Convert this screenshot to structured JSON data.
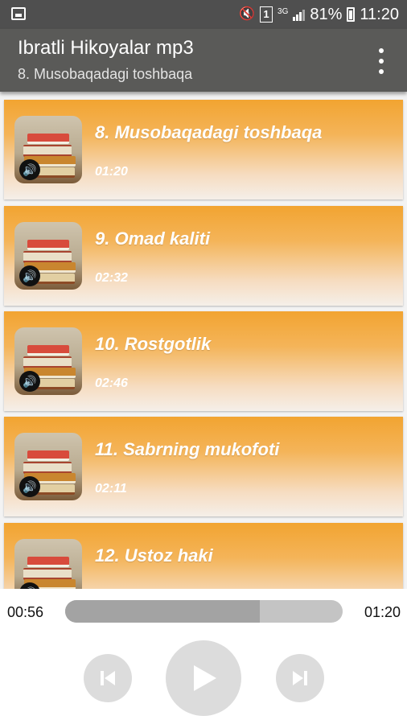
{
  "status_bar": {
    "battery_percent": "81%",
    "time": "11:20",
    "network": "3G",
    "sim_slot": "1",
    "icons": [
      "image-icon",
      "mute-icon",
      "sim-icon",
      "signal-icon",
      "battery-charging-icon"
    ]
  },
  "app_bar": {
    "title": "Ibratli Hikoyalar mp3",
    "subtitle": "8. Musobaqadagi toshbaqa",
    "menu_icon": "overflow-menu-icon"
  },
  "tracks": [
    {
      "title": "8. Musobaqadagi toshbaqa",
      "duration": "01:20"
    },
    {
      "title": "9. Omad kaliti",
      "duration": "02:32"
    },
    {
      "title": "10. Rostgotlik",
      "duration": "02:46"
    },
    {
      "title": "11. Sabrning mukofoti",
      "duration": "02:11"
    },
    {
      "title": "12. Ustoz haki",
      "duration": ""
    }
  ],
  "player": {
    "current_time": "00:56",
    "total_time": "01:20",
    "progress_fraction": 0.7,
    "buttons": [
      "previous-icon",
      "play-icon",
      "next-icon"
    ]
  },
  "colors": {
    "card_top": "#f2a431",
    "card_bottom": "#f5efe9",
    "app_bar": "#5a5a58",
    "status_bar": "#4f4f4f"
  }
}
